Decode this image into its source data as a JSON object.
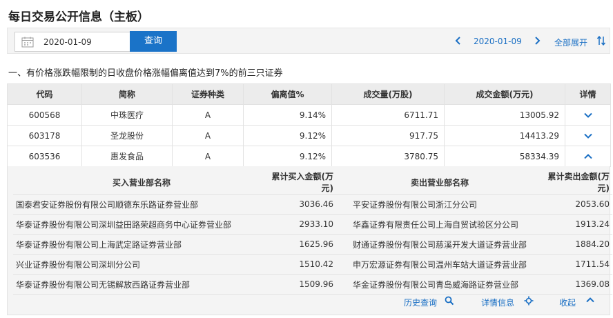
{
  "page": {
    "title": "每日交易公开信息（主板）"
  },
  "toolbar": {
    "date_value": "2020-01-09",
    "query_label": "查询",
    "nav_date": "2020-01-09",
    "expand_all_label": "全部展开"
  },
  "section": {
    "title": "一、有价格涨跌幅限制的日收盘价格涨幅偏离值达到7%的前三只证券"
  },
  "table": {
    "headers": [
      "代码",
      "简称",
      "证券种类",
      "偏离值%",
      "成交量(万股)",
      "成交金额(万元)",
      "详情"
    ],
    "rows": [
      {
        "code": "600568",
        "name": "中珠医疗",
        "type": "A",
        "deviation": "9.14%",
        "volume": "6711.71",
        "amount": "13005.92",
        "expanded": false
      },
      {
        "code": "603178",
        "name": "圣龙股份",
        "type": "A",
        "deviation": "9.12%",
        "volume": "917.75",
        "amount": "14413.29",
        "expanded": false
      },
      {
        "code": "603536",
        "name": "惠发食品",
        "type": "A",
        "deviation": "9.12%",
        "volume": "3780.75",
        "amount": "58334.39",
        "expanded": true
      }
    ]
  },
  "detail": {
    "headers": [
      "买入营业部名称",
      "累计买入金额(万元)",
      "卖出营业部名称",
      "累计卖出金额(万元)"
    ],
    "rows": [
      {
        "buy_name": "国泰君安证券股份有限公司顺德东乐路证券营业部",
        "buy_amount": "3036.46",
        "sell_name": "平安证券股份有限公司浙江分公司",
        "sell_amount": "2053.60"
      },
      {
        "buy_name": "华泰证券股份有限公司深圳益田路荣超商务中心证券营业部",
        "buy_amount": "2933.10",
        "sell_name": "华鑫证券有限责任公司上海自贸试验区分公司",
        "sell_amount": "1913.24"
      },
      {
        "buy_name": "华泰证券股份有限公司上海武定路证券营业部",
        "buy_amount": "1625.96",
        "sell_name": "财通证券股份有限公司慈溪开发大道证券营业部",
        "sell_amount": "1884.20"
      },
      {
        "buy_name": "兴业证券股份有限公司深圳分公司",
        "buy_amount": "1510.42",
        "sell_name": "申万宏源证券有限公司温州车站大道证券营业部",
        "sell_amount": "1711.54"
      },
      {
        "buy_name": "华泰证券股份有限公司无锡解放西路证券营业部",
        "buy_amount": "1509.96",
        "sell_name": "华金证券股份有限公司青岛威海路证券营业部",
        "sell_amount": "1369.08"
      }
    ],
    "history_label": "历史查询",
    "detail_info_label": "详情信息",
    "collapse_label": "收起"
  },
  "colors": {
    "accent": "#1a73c8",
    "link": "#1a6fc4",
    "header_bg": "#ececec",
    "panel_bg": "#f4f4f4"
  },
  "icons": [
    "calendar-icon",
    "chevron-left-icon",
    "chevron-right-icon",
    "sort-icon",
    "chevron-down-icon",
    "chevron-up-icon",
    "search-icon",
    "crosshair-icon"
  ]
}
